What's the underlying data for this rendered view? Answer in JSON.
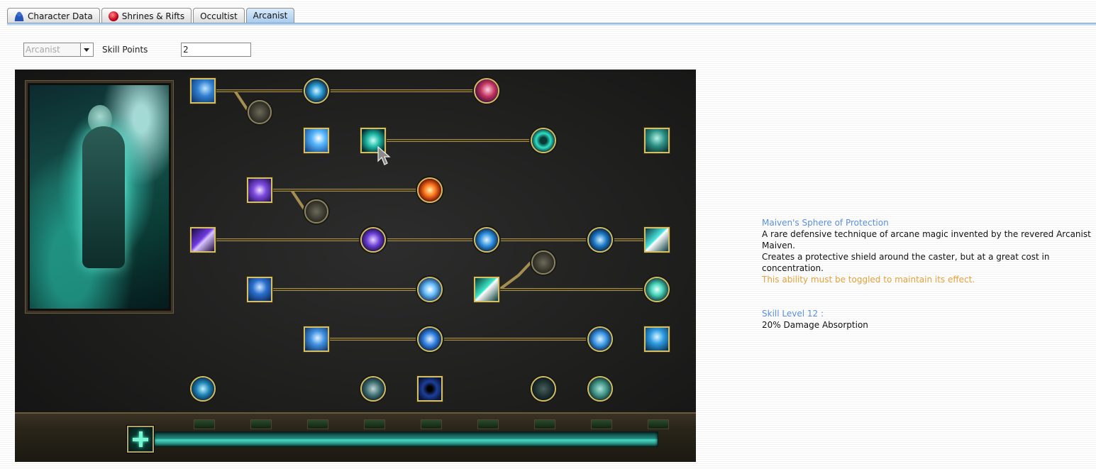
{
  "tabs": [
    {
      "label": "Character Data",
      "icon": "person-icon",
      "active": false
    },
    {
      "label": "Shrines & Rifts",
      "icon": "shrine-icon",
      "active": false
    },
    {
      "label": "Occultist",
      "icon": null,
      "active": false
    },
    {
      "label": "Arcanist",
      "icon": null,
      "active": true
    }
  ],
  "toolbar": {
    "mastery_select": "Arcanist",
    "skill_points_label": "Skill Points",
    "skill_points_value": "2"
  },
  "skill_tree": {
    "mastery": "Arcanist",
    "skills": [
      {
        "name": "skill-r1-a",
        "shape": "square",
        "theme": "blue-beam"
      },
      {
        "name": "skill-r1-b",
        "shape": "round",
        "theme": "lightning-orb"
      },
      {
        "name": "skill-r1-c",
        "shape": "round",
        "theme": "crimson-swirl"
      },
      {
        "name": "skill-r1-mod",
        "shape": "round",
        "theme": "empty-rune"
      },
      {
        "name": "skill-r2-a",
        "shape": "square",
        "theme": "ice-spark"
      },
      {
        "name": "maivens-sphere-of-protection",
        "shape": "square",
        "theme": "teal-shield",
        "selected": true
      },
      {
        "name": "skill-r2-b",
        "shape": "round",
        "theme": "teal-ring"
      },
      {
        "name": "skill-r2-c",
        "shape": "square",
        "theme": "teal-guardian"
      },
      {
        "name": "skill-r3-a",
        "shape": "square",
        "theme": "violet-burst"
      },
      {
        "name": "skill-r3-b",
        "shape": "round",
        "theme": "fire-orb"
      },
      {
        "name": "skill-r3-mod",
        "shape": "round",
        "theme": "empty-rune"
      },
      {
        "name": "skill-r4-a",
        "shape": "square",
        "theme": "violet-bolt"
      },
      {
        "name": "skill-r4-b",
        "shape": "round",
        "theme": "violet-bolt"
      },
      {
        "name": "skill-r4-c",
        "shape": "round",
        "theme": "blue-bolt"
      },
      {
        "name": "skill-r4-d",
        "shape": "round",
        "theme": "blue-flare"
      },
      {
        "name": "skill-r4-e",
        "shape": "square",
        "theme": "ice-shards"
      },
      {
        "name": "skill-r5-a",
        "shape": "square",
        "theme": "blue-crown"
      },
      {
        "name": "skill-r5-b",
        "shape": "round",
        "theme": "frost-flake"
      },
      {
        "name": "skill-r5-c",
        "shape": "square",
        "theme": "teal-slash"
      },
      {
        "name": "skill-r5-mod",
        "shape": "round",
        "theme": "empty-rune"
      },
      {
        "name": "skill-r5-d",
        "shape": "round",
        "theme": "teal-skull"
      },
      {
        "name": "skill-r6-a",
        "shape": "square",
        "theme": "blue-wave"
      },
      {
        "name": "skill-r6-b",
        "shape": "round",
        "theme": "blue-star"
      },
      {
        "name": "skill-r6-c",
        "shape": "round",
        "theme": "blue-swirl"
      },
      {
        "name": "skill-r6-d",
        "shape": "square",
        "theme": "blue-rain"
      },
      {
        "name": "skill-r7-a",
        "shape": "round",
        "theme": "meditate"
      },
      {
        "name": "skill-r7-b",
        "shape": "round",
        "theme": "fist"
      },
      {
        "name": "skill-r7-c",
        "shape": "square",
        "theme": "void-vortex"
      },
      {
        "name": "skill-r7-d",
        "shape": "round",
        "theme": "dark-crystal"
      },
      {
        "name": "skill-r7-e",
        "shape": "round",
        "theme": "tome"
      }
    ]
  },
  "description": {
    "title": "Maiven's Sphere of Protection",
    "line1": "A rare defensive technique of arcane magic invented by the revered Arcanist Maiven.",
    "line2": "Creates a protective shield around the caster, but at a great cost in concentration.",
    "note": "This ability must be toggled to maintain its effect.",
    "level_label": "Skill Level 12 :",
    "level_effect": "20% Damage Absorption"
  },
  "colors": {
    "title_blue": "#5a8fde",
    "note_orange": "#e3a13a",
    "frame_gold": "#d4be6a",
    "panel_dark": "#1e1e1d",
    "bar_teal": "#4ad8c5"
  }
}
